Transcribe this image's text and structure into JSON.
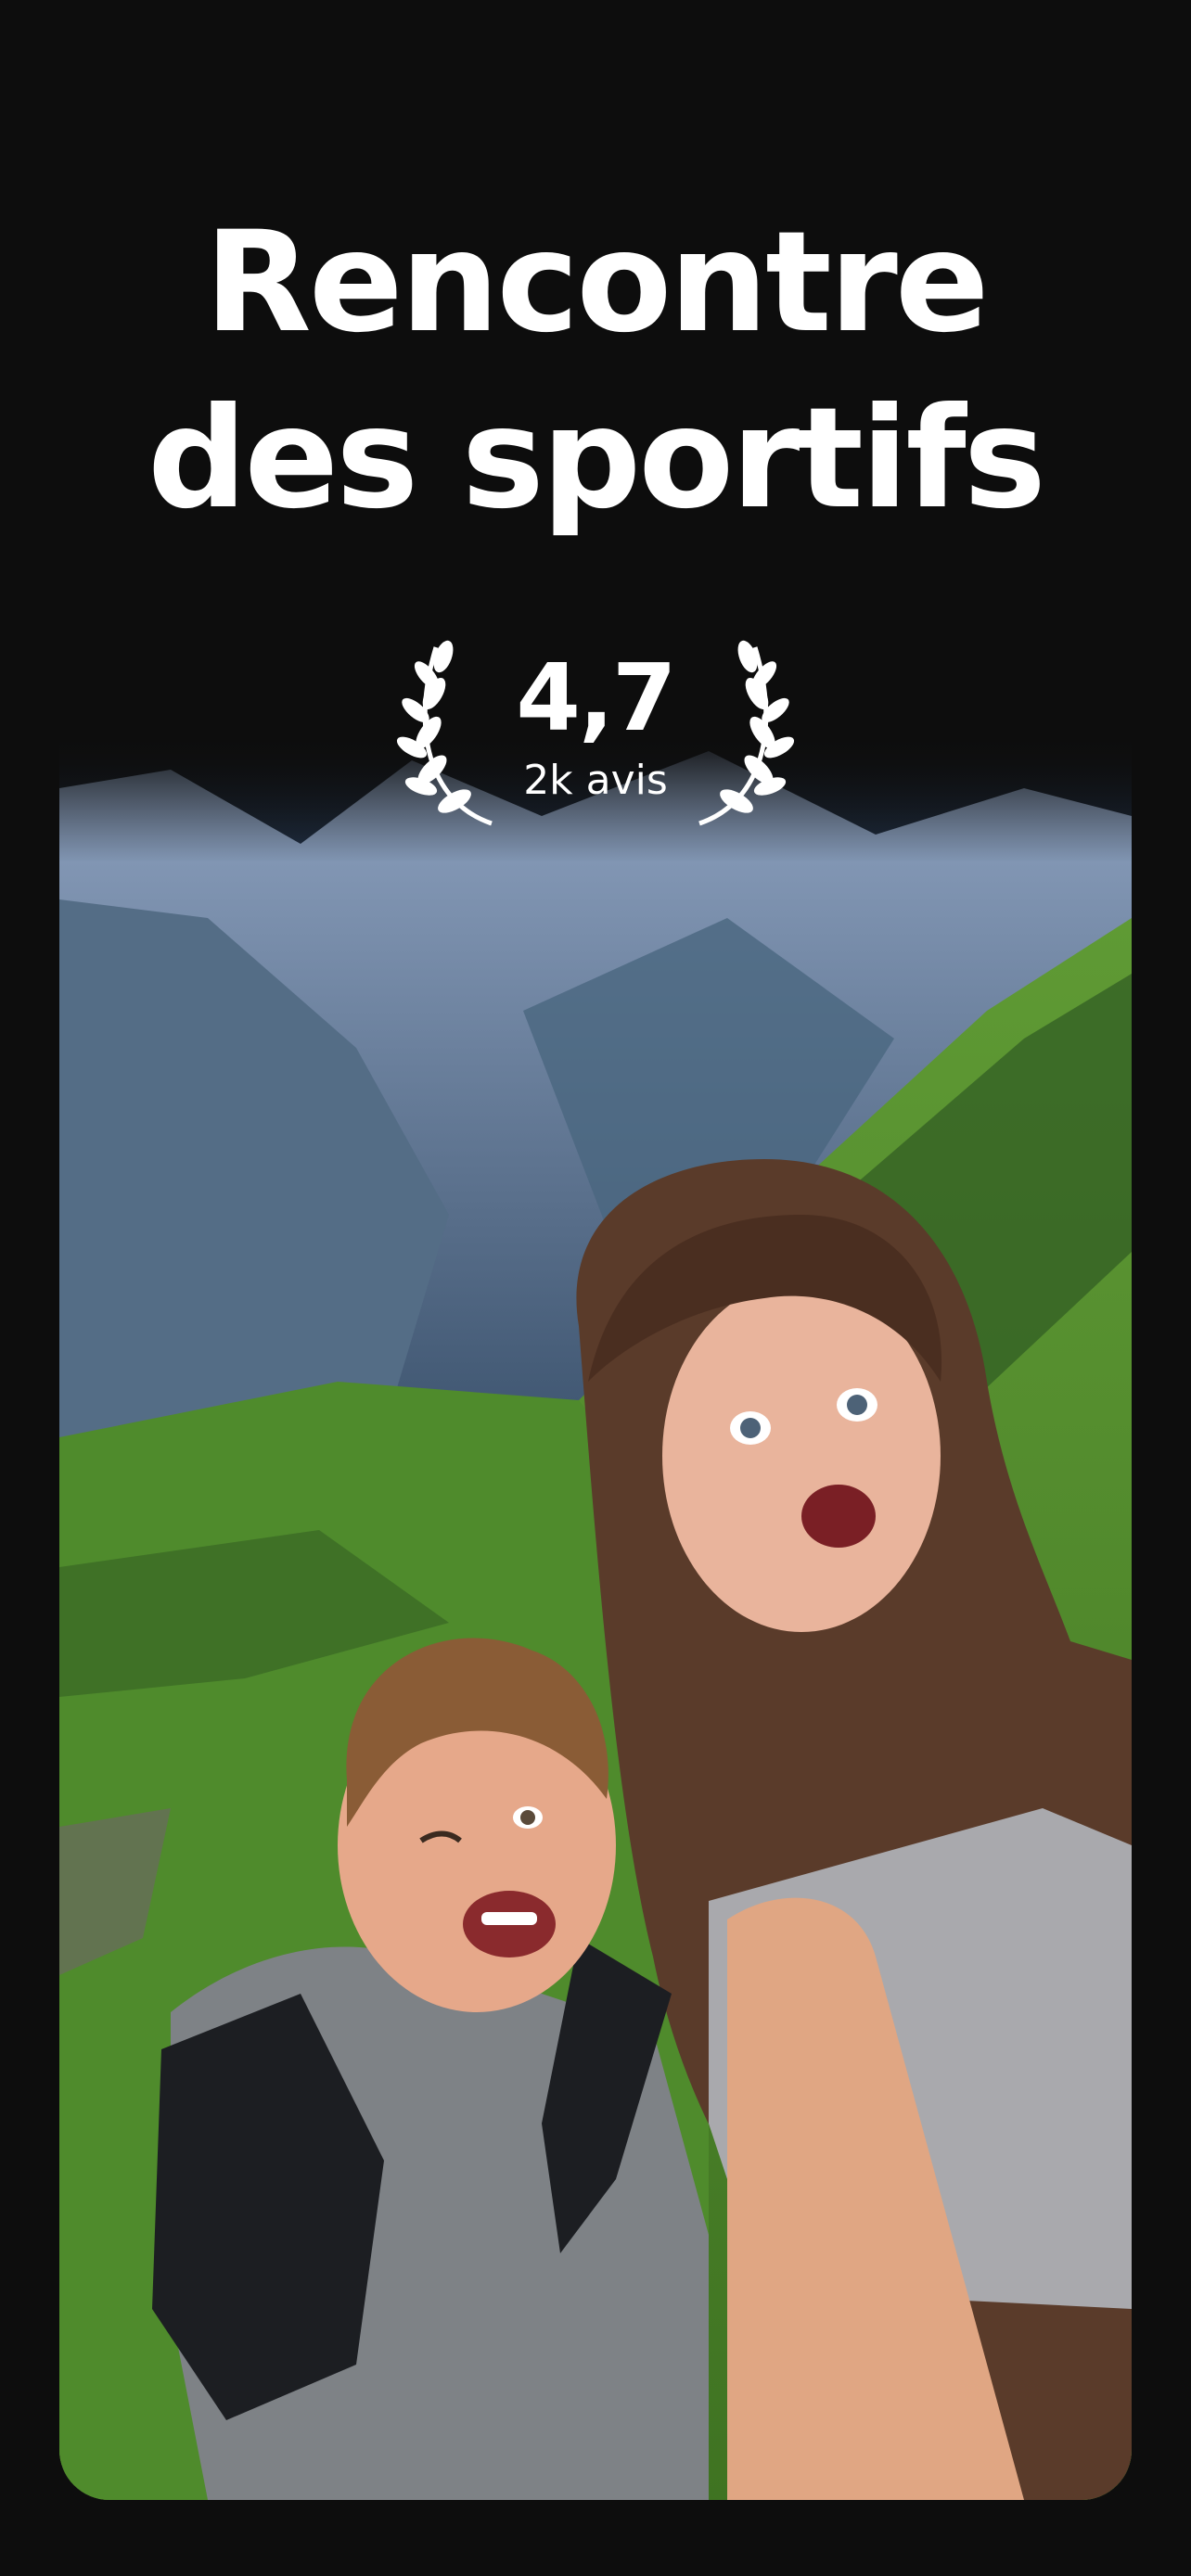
{
  "headline": {
    "line1": "Rencontre",
    "line2": "des sportifs"
  },
  "rating": {
    "value": "4,7",
    "count": "2k avis",
    "icon": "laurel-wreath-icon"
  },
  "photo": {
    "subject": "selfie-photo"
  },
  "colors": {
    "background": "#0d0d0d",
    "text": "#ffffff"
  }
}
